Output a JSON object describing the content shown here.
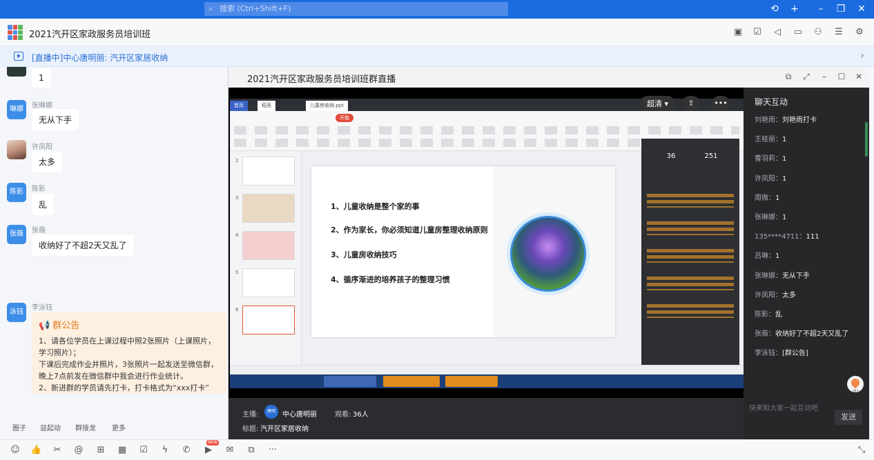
{
  "search": {
    "placeholder": "搜索 (Ctrl+Shift+F)"
  },
  "group": {
    "title": "2021汽开区家政服务员培训班"
  },
  "banner": {
    "text": "[直播中]中心唐明丽: 汽开区家居收纳"
  },
  "chat": {
    "messages": [
      {
        "sender": "",
        "avatar": "",
        "text": "1"
      },
      {
        "sender": "张琳娜",
        "avatar": "琳娜",
        "text": "无从下手"
      },
      {
        "sender": "许凤阳",
        "avatar": "",
        "text": "太多"
      },
      {
        "sender": "陈影",
        "avatar": "陈影",
        "text": "乱"
      },
      {
        "sender": "张薇",
        "avatar": "张薇",
        "text": "收纳好了不超2天又乱了"
      }
    ],
    "notice": {
      "sender": "李泳钰",
      "avatar": "泳钰",
      "title": "群公告",
      "body": "1、请各位学员在上课过程中照2张照片（上课照片，学习照片）；\n下课后完成作业并照片，3张照片一起发送至微信群，晚上7点前发在微信群中我会进行作业统计。\n2、新进群的学员请先打卡，打卡格式为“xxx打卡”"
    }
  },
  "tabs": [
    "圈子",
    "益起动",
    "群接龙",
    "更多"
  ],
  "toolbar": {
    "new_tag": "NEW"
  },
  "live": {
    "window_title": "2021汽开区家政服务员培训班群直播",
    "quality": "超清",
    "more": "•••",
    "host_label": "主播:",
    "host_name": "中心唐明丽",
    "host_avatar": "唐明",
    "views_label": "观看:",
    "views": "36人",
    "topic_label": "标题:",
    "topic": "汽开区家居收纳",
    "slide_points": [
      "1、儿童收纳是整个家的事",
      "2、作为家长，你必须知道儿童房整理收纳原则",
      "3、儿童房收纳技巧",
      "4、循序渐进的培养孩子的整理习惯"
    ],
    "screen_chat_counts": [
      "36",
      "251"
    ],
    "ribbon_tab": "开始"
  },
  "interaction": {
    "title": "聊天互动",
    "messages": [
      {
        "name": "刘艳雨：",
        "text": "刘艳雨打卡"
      },
      {
        "name": "王桂丽：",
        "text": "1"
      },
      {
        "name": "曹羽莉：",
        "text": "1"
      },
      {
        "name": "许凤阳：",
        "text": "1"
      },
      {
        "name": "周微：",
        "text": "1"
      },
      {
        "name": "张琳娜：",
        "text": "1"
      },
      {
        "name": "135****4711：",
        "text": "111"
      },
      {
        "name": "吕琳：",
        "text": "1"
      },
      {
        "name": "张琳娜：",
        "text": "无从下手"
      },
      {
        "name": "许凤阳：",
        "text": "太多"
      },
      {
        "name": "陈影：",
        "text": "乱"
      },
      {
        "name": "张薇：",
        "text": "收纳好了不超2天又乱了"
      },
      {
        "name": "李泳钰：",
        "text": "[群公告]"
      }
    ],
    "input_placeholder": "快来和大家一起互动吧",
    "send": "发送",
    "ring_count": "251"
  },
  "colors": {
    "accent": "#1a6ae0",
    "notice_bg": "#fdf0e1",
    "notice_title": "#e47a1c"
  }
}
